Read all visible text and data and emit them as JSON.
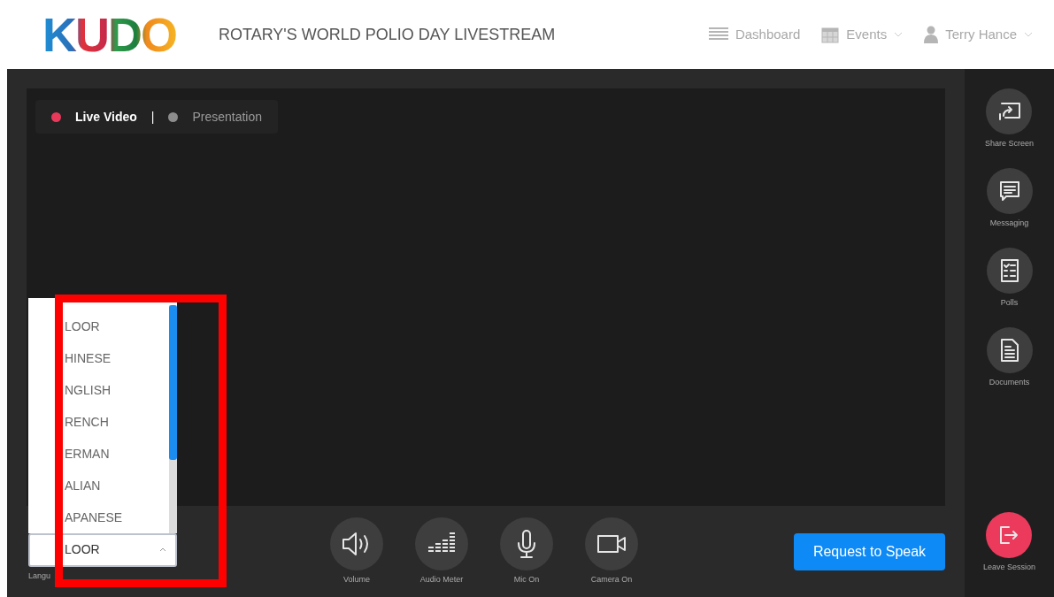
{
  "header": {
    "logo": "KUDO",
    "title": "ROTARY'S WORLD POLIO DAY LIVESTREAM",
    "nav": [
      {
        "label": "Dashboard",
        "kind": "dashboard"
      },
      {
        "label": "Events",
        "kind": "events"
      },
      {
        "label": "Terry Hance",
        "kind": "user"
      }
    ]
  },
  "stage": {
    "separator": "|",
    "sources": [
      {
        "label": "Live Video",
        "selected": true,
        "color": "#e8395a"
      },
      {
        "label": "Presentation",
        "selected": false,
        "color": "#8c8c8c"
      }
    ]
  },
  "language": {
    "options": [
      "LOOR",
      "HINESE",
      "NGLISH",
      "RENCH",
      "ERMAN",
      "ALIAN",
      "APANESE"
    ],
    "value": "LOOR",
    "label": "Langu"
  },
  "controls": [
    {
      "label": "Volume",
      "kind": "volume"
    },
    {
      "label": "Audio Meter",
      "kind": "meter"
    },
    {
      "label": "Mic On",
      "kind": "mic"
    },
    {
      "label": "Camera On",
      "kind": "camera"
    }
  ],
  "request_button": "Request to Speak",
  "side_actions": [
    {
      "label": "Share Screen",
      "kind": "share"
    },
    {
      "label": "Messaging",
      "kind": "message"
    },
    {
      "label": "Polls",
      "kind": "polls"
    },
    {
      "label": "Documents",
      "kind": "document"
    },
    {
      "label": "Leave Session",
      "kind": "leave"
    }
  ]
}
